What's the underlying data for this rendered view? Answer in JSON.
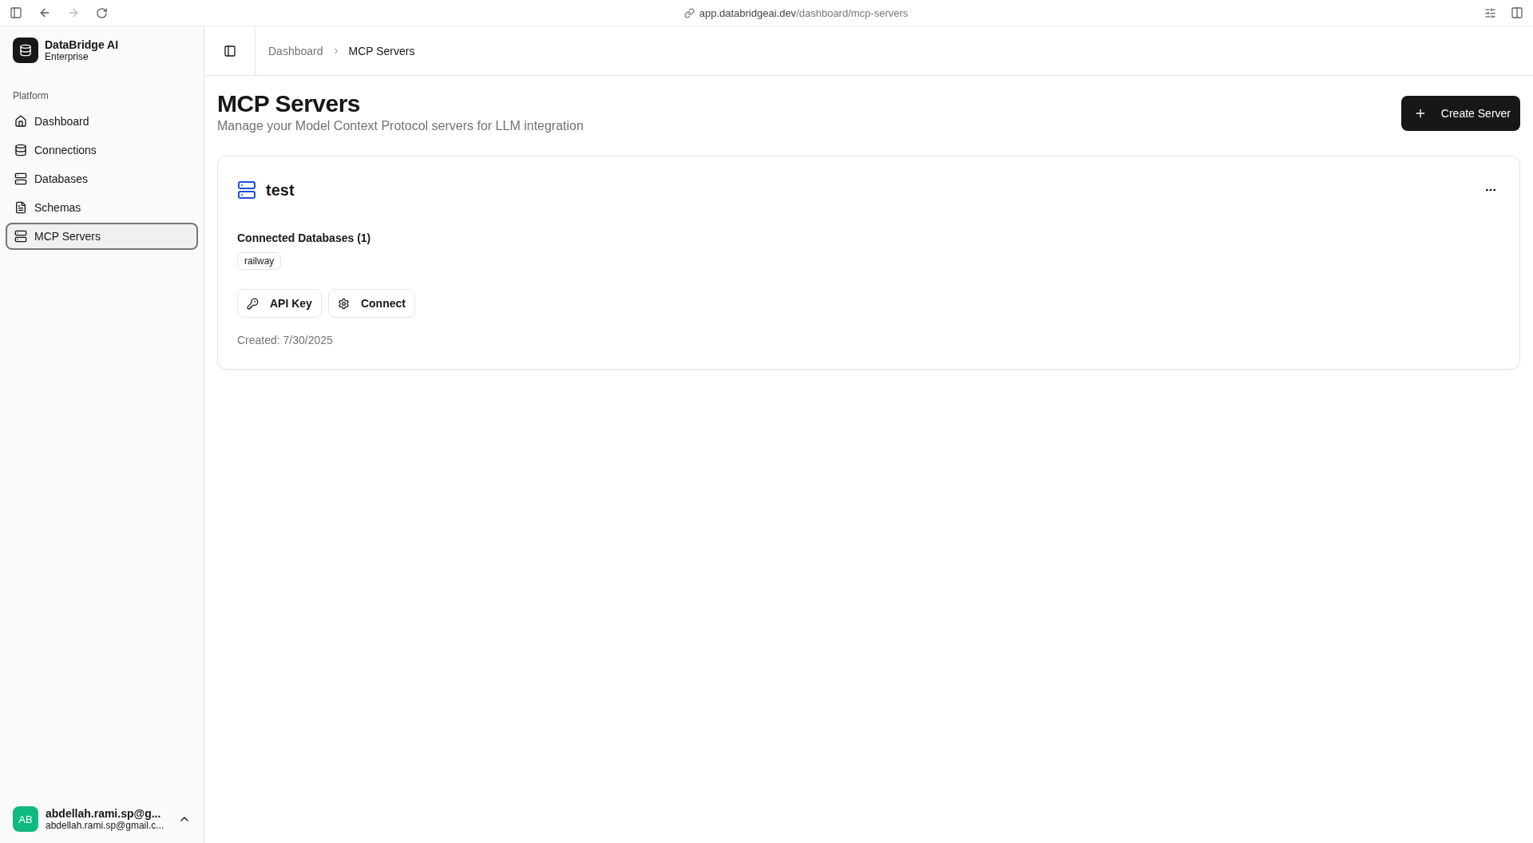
{
  "browser": {
    "url_host": "app.databridgeai.dev",
    "url_path": "/dashboard/mcp-servers"
  },
  "sidebar": {
    "brand": {
      "name": "DataBridge AI",
      "plan": "Enterprise"
    },
    "section": "Platform",
    "items": [
      {
        "label": "Dashboard",
        "kind": "home",
        "selected": false
      },
      {
        "label": "Connections",
        "kind": "database",
        "selected": false
      },
      {
        "label": "Databases",
        "kind": "server",
        "selected": false
      },
      {
        "label": "Schemas",
        "kind": "file",
        "selected": false
      },
      {
        "label": "MCP Servers",
        "kind": "server",
        "selected": true
      }
    ],
    "user": {
      "initials": "AB",
      "name": "abdellah.rami.sp@g...",
      "email": "abdellah.rami.sp@gmail.c..."
    }
  },
  "breadcrumb": [
    "Dashboard",
    "MCP Servers"
  ],
  "page": {
    "title": "MCP Servers",
    "subtitle": "Manage your Model Context Protocol servers for LLM integration",
    "action": "Create Server"
  },
  "servers": [
    {
      "name": "test",
      "databases_label": "Connected Databases (1)",
      "databases": [
        "railway"
      ],
      "buttons": [
        {
          "label": "API Key",
          "kind": "key"
        },
        {
          "label": "Connect",
          "kind": "gear"
        }
      ],
      "created": "Created: 7/30/2025"
    }
  ]
}
